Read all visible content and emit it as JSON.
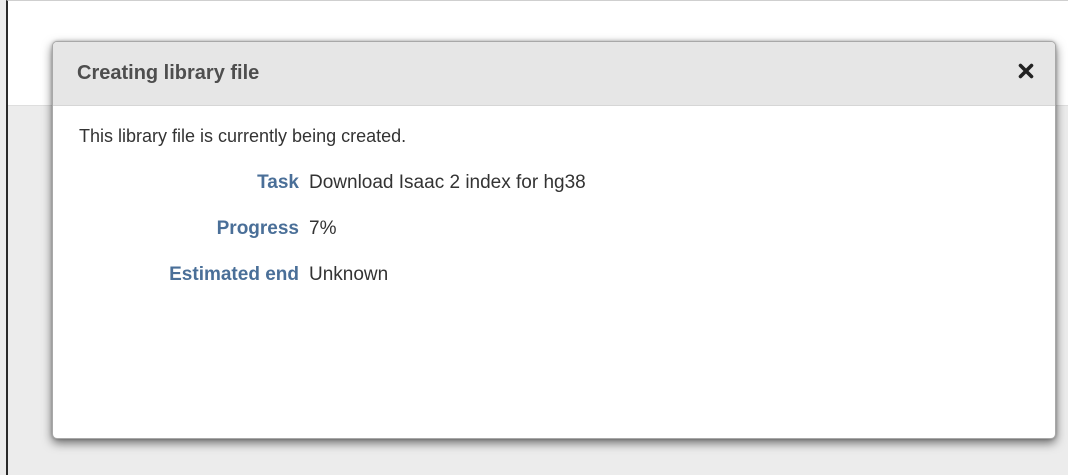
{
  "modal": {
    "title": "Creating library file",
    "close_icon": "close-icon",
    "message": "This library file is currently being created.",
    "details": [
      {
        "label": "Task",
        "value": "Download Isaac 2 index for hg38"
      },
      {
        "label": "Progress",
        "value": "7%"
      },
      {
        "label": "Estimated end",
        "value": "Unknown"
      }
    ]
  },
  "colors": {
    "label_blue": "#4a6f98",
    "header_gray": "#e6e6e6",
    "backdrop_gray": "#ececec"
  }
}
